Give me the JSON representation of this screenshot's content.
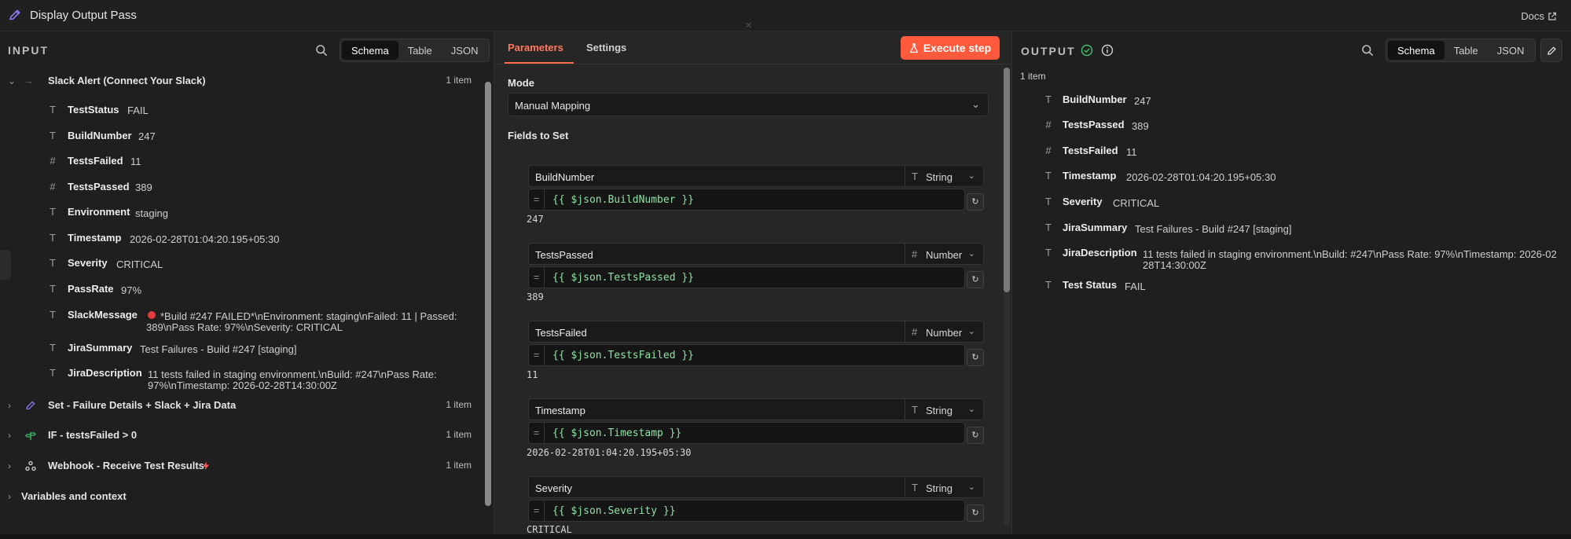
{
  "header": {
    "title": "Display Output Pass",
    "docs_label": "Docs",
    "close_label": "✕"
  },
  "input": {
    "label": "INPUT",
    "view_tabs": [
      "Schema",
      "Table",
      "JSON"
    ],
    "node": {
      "name": "Slack Alert (Connect Your Slack)",
      "count": "1 item"
    },
    "fields": [
      {
        "type": "T",
        "name": "TestStatus",
        "value": "FAIL"
      },
      {
        "type": "T",
        "name": "BuildNumber",
        "value": "247"
      },
      {
        "type": "#",
        "name": "TestsFailed",
        "value": "11"
      },
      {
        "type": "#",
        "name": "TestsPassed",
        "value": "389"
      },
      {
        "type": "T",
        "name": "Environment",
        "value": "staging"
      },
      {
        "type": "T",
        "name": "Timestamp",
        "value": "2026-02-28T01:04:20.195+05:30"
      },
      {
        "type": "T",
        "name": "Severity",
        "value": "CRITICAL"
      },
      {
        "type": "T",
        "name": "PassRate",
        "value": "97%"
      },
      {
        "type": "T",
        "name": "SlackMessage",
        "value_line1": "*Build #247 FAILED*\\nEnvironment: staging\\nFailed: 11 | Passed:",
        "value_line2": "389\\nPass Rate: 97%\\nSeverity: CRITICAL"
      },
      {
        "type": "T",
        "name": "JiraSummary",
        "value": "Test Failures - Build #247 [staging]"
      },
      {
        "type": "T",
        "name": "JiraDescription",
        "value_line1": "11 tests failed in staging environment.\\nBuild: #247\\nPass Rate:",
        "value_line2": "97%\\nTimestamp: 2026-02-28T14:30:00Z"
      }
    ],
    "other_nodes": [
      {
        "name": "Set - Failure Details + Slack + Jira Data",
        "count": "1 item"
      },
      {
        "name": "IF - testsFailed > 0",
        "count": "1 item"
      },
      {
        "name": "Webhook - Receive Test Results",
        "count": "1 item"
      }
    ],
    "variables_label": "Variables and context"
  },
  "params": {
    "tabs": [
      "Parameters",
      "Settings"
    ],
    "execute_label": "Execute step",
    "mode_label": "Mode",
    "mode_value": "Manual Mapping",
    "fields_label": "Fields to Set",
    "assignments": [
      {
        "name": "BuildNumber",
        "type_glyph": "T",
        "type": "String",
        "expr": "{{ $json.BuildNumber }}",
        "preview": "247"
      },
      {
        "name": "TestsPassed",
        "type_glyph": "#",
        "type": "Number",
        "expr": "{{ $json.TestsPassed }}",
        "preview": "389"
      },
      {
        "name": "TestsFailed",
        "type_glyph": "#",
        "type": "Number",
        "expr": "{{ $json.TestsFailed }}",
        "preview": "11"
      },
      {
        "name": "Timestamp",
        "type_glyph": "T",
        "type": "String",
        "expr": "{{ $json.Timestamp }}",
        "preview": "2026-02-28T01:04:20.195+05:30"
      },
      {
        "name": "Severity",
        "type_glyph": "T",
        "type": "String",
        "expr": "{{ $json.Severity }}",
        "preview": "CRITICAL"
      }
    ]
  },
  "output": {
    "label": "OUTPUT",
    "count": "1 item",
    "view_tabs": [
      "Schema",
      "Table",
      "JSON"
    ],
    "fields": [
      {
        "type": "T",
        "name": "BuildNumber",
        "value": "247"
      },
      {
        "type": "#",
        "name": "TestsPassed",
        "value": "389"
      },
      {
        "type": "#",
        "name": "TestsFailed",
        "value": "11"
      },
      {
        "type": "T",
        "name": "Timestamp",
        "value": "2026-02-28T01:04:20.195+05:30"
      },
      {
        "type": "T",
        "name": "Severity",
        "value": "CRITICAL"
      },
      {
        "type": "T",
        "name": "JiraSummary",
        "value": "Test Failures - Build #247 [staging]"
      },
      {
        "type": "T",
        "name": "JiraDescription",
        "value_line1": "11 tests failed in staging environment.\\nBuild: #247\\nPass Rate: 97%\\nTimestamp: 2026-02",
        "value_line2": "28T14:30:00Z"
      },
      {
        "type": "T",
        "name": "Test Status",
        "value": "FAIL"
      }
    ]
  },
  "colors": {
    "accent": "#ff6d4d",
    "execute": "#ff5a3c",
    "expression": "#8fe0a4",
    "success": "#3fbf6b",
    "background": "#1e1e1e"
  }
}
